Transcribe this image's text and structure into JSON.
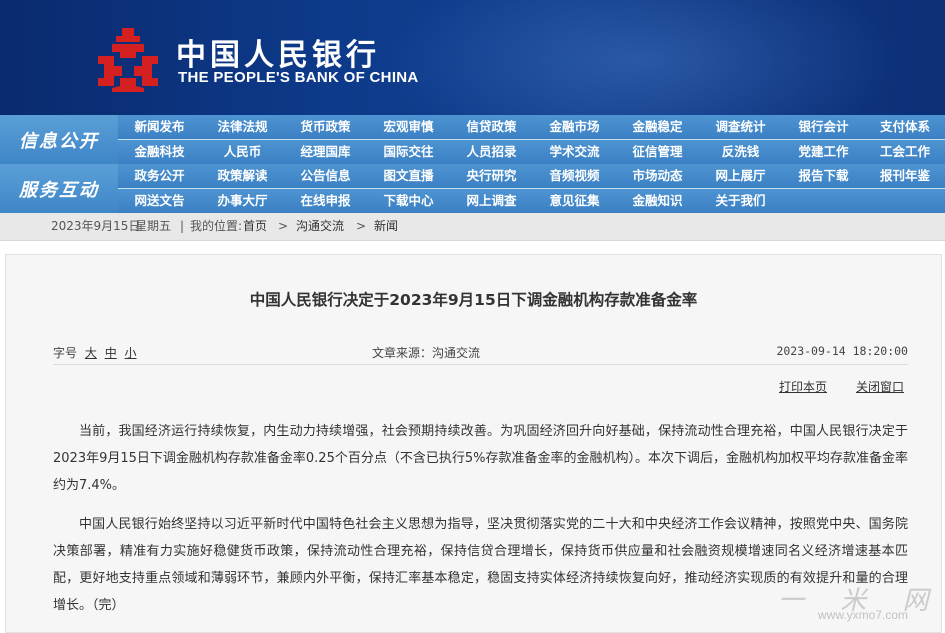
{
  "header": {
    "bank_cn": "中国人民银行",
    "bank_en": "THE PEOPLE'S BANK OF CHINA",
    "logo_icon": "pboc-emblem-icon",
    "brand_color": "#0d3a8a",
    "logo_color": "#d42020"
  },
  "nav": {
    "section1_label": "信息公开",
    "section2_label": "服务互动",
    "section1_items": [
      [
        "新闻发布",
        "法律法规",
        "货币政策",
        "宏观审慎",
        "信贷政策",
        "金融市场",
        "金融稳定",
        "调查统计",
        "银行会计",
        "支付体系"
      ],
      [
        "金融科技",
        "人民币",
        "经理国库",
        "国际交往",
        "人员招录",
        "学术交流",
        "征信管理",
        "反洗钱",
        "党建工作",
        "工会工作"
      ]
    ],
    "section2_items": [
      [
        "政务公开",
        "政策解读",
        "公告信息",
        "图文直播",
        "央行研究",
        "音频视频",
        "市场动态",
        "网上展厅",
        "报告下载",
        "报刊年鉴"
      ],
      [
        "网送文告",
        "办事大厅",
        "在线申报",
        "下载中心",
        "网上调查",
        "意见征集",
        "金融知识",
        "关于我们",
        "",
        ""
      ]
    ]
  },
  "breadcrumb": {
    "date": "2023年9月15日",
    "weekday": "星期五",
    "location_label": "我的位置:",
    "home": "首页",
    "section": "沟通交流",
    "page": "新闻",
    "sep": "|",
    "arrow": ">"
  },
  "article": {
    "title": "中国人民银行决定于2023年9月15日下调金融机构存款准备金率",
    "font_size_label": "字号",
    "size_large": "大",
    "size_medium": "中",
    "size_small": "小",
    "source": "文章来源：沟通交流",
    "time": "2023-09-14 18:20:00",
    "print_label": "打印本页",
    "close_label": "关闭窗口",
    "paragraphs": [
      "当前，我国经济运行持续恢复，内生动力持续增强，社会预期持续改善。为巩固经济回升向好基础，保持流动性合理充裕，中国人民银行决定于2023年9月15日下调金融机构存款准备金率0.25个百分点（不含已执行5%存款准备金率的金融机构）。本次下调后，金融机构加权平均存款准备金率约为7.4%。",
      "中国人民银行始终坚持以习近平新时代中国特色社会主义思想为指导，坚决贯彻落实党的二十大和中央经济工作会议精神，按照党中央、国务院决策部署，精准有力实施好稳健货币政策，保持流动性合理充裕，保持信贷合理增长，保持货币供应量和社会融资规模增速同名义经济增速基本匹配，更好地支持重点领域和薄弱环节，兼顾内外平衡，保持汇率基本稳定，稳固支持实体经济持续恢复向好，推动经济实现质的有效提升和量的合理增长。（完）"
    ]
  },
  "watermark": {
    "text": "一 米 网",
    "url": "www.yxmo7.com"
  }
}
